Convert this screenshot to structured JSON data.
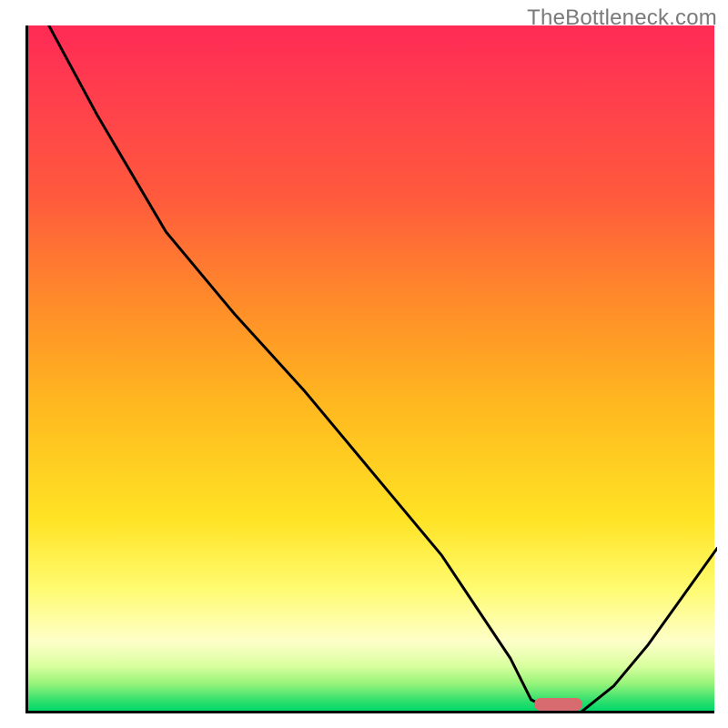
{
  "watermark": "TheBottleneck.com",
  "chart_data": {
    "type": "line",
    "title": "",
    "xlabel": "",
    "ylabel": "",
    "xlim": [
      0,
      100
    ],
    "ylim": [
      0,
      100
    ],
    "grid": false,
    "series": [
      {
        "name": "bottleneck-curve",
        "x": [
          3,
          10,
          20,
          30,
          40,
          50,
          60,
          70,
          73,
          77,
          80,
          85,
          90,
          100
        ],
        "values": [
          100,
          87,
          70,
          58,
          47,
          35,
          23,
          8,
          2,
          0,
          0,
          4,
          10,
          24
        ]
      }
    ],
    "annotations": [
      {
        "name": "optimal-marker",
        "x_center": 77,
        "width_pct": 7,
        "color": "#d86b6f"
      }
    ]
  },
  "colors": {
    "gradient_top": "#ff2a55",
    "gradient_bottom": "#00d86a",
    "axis": "#000000",
    "curve": "#000000",
    "marker": "#d86b6f",
    "watermark": "#7a7a7a"
  }
}
